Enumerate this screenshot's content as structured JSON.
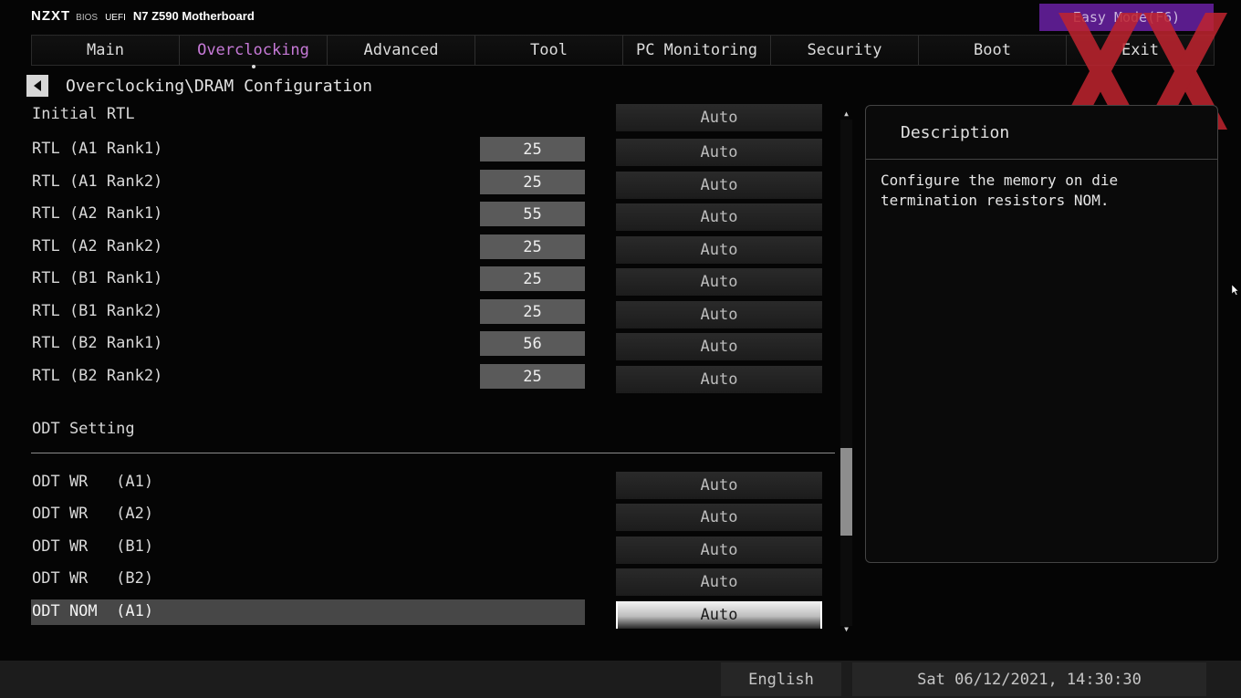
{
  "brand": {
    "logo": "NZXT",
    "bios": "BIOS",
    "uefi": "UEFI",
    "board": "N7 Z590 Motherboard"
  },
  "easy_mode_label": "Easy Mode(F6)",
  "tabs": [
    {
      "label": "Main",
      "active": false
    },
    {
      "label": "Overclocking",
      "active": true
    },
    {
      "label": "Advanced",
      "active": false
    },
    {
      "label": "Tool",
      "active": false
    },
    {
      "label": "PC Monitoring",
      "active": false
    },
    {
      "label": "Security",
      "active": false
    },
    {
      "label": "Boot",
      "active": false
    },
    {
      "label": "Exit",
      "active": false
    }
  ],
  "breadcrumb": "Overclocking\\DRAM Configuration",
  "rtl_rows": [
    {
      "label": "Initial RTL",
      "current": null,
      "option": "Auto"
    },
    {
      "label": "RTL (A1 Rank1)",
      "current": "25",
      "option": "Auto"
    },
    {
      "label": "RTL (A1 Rank2)",
      "current": "25",
      "option": "Auto"
    },
    {
      "label": "RTL (A2 Rank1)",
      "current": "55",
      "option": "Auto"
    },
    {
      "label": "RTL (A2 Rank2)",
      "current": "25",
      "option": "Auto"
    },
    {
      "label": "RTL (B1 Rank1)",
      "current": "25",
      "option": "Auto"
    },
    {
      "label": "RTL (B1 Rank2)",
      "current": "25",
      "option": "Auto"
    },
    {
      "label": "RTL (B2 Rank1)",
      "current": "56",
      "option": "Auto"
    },
    {
      "label": "RTL (B2 Rank2)",
      "current": "25",
      "option": "Auto"
    }
  ],
  "odt_section_title": "ODT Setting",
  "odt_rows": [
    {
      "label": "ODT WR   (A1)",
      "option": "Auto",
      "selected": false
    },
    {
      "label": "ODT WR   (A2)",
      "option": "Auto",
      "selected": false
    },
    {
      "label": "ODT WR   (B1)",
      "option": "Auto",
      "selected": false
    },
    {
      "label": "ODT WR   (B2)",
      "option": "Auto",
      "selected": false
    },
    {
      "label": "ODT NOM  (A1)",
      "option": "Auto",
      "selected": true
    }
  ],
  "description": {
    "title": "Description",
    "text": "Configure the memory on die\ntermination resistors NOM."
  },
  "footer": {
    "language": "English",
    "datetime": "Sat 06/12/2021, 14:30:30"
  },
  "colors": {
    "accent": "#c77ad8",
    "easy_mode_bg": "#5a1c8c",
    "watermark": "#c0242f"
  },
  "icons": [
    "back-arrow-icon",
    "scroll-up-icon",
    "scroll-down-icon",
    "mouse-cursor-icon",
    "watermark-logo-icon"
  ]
}
